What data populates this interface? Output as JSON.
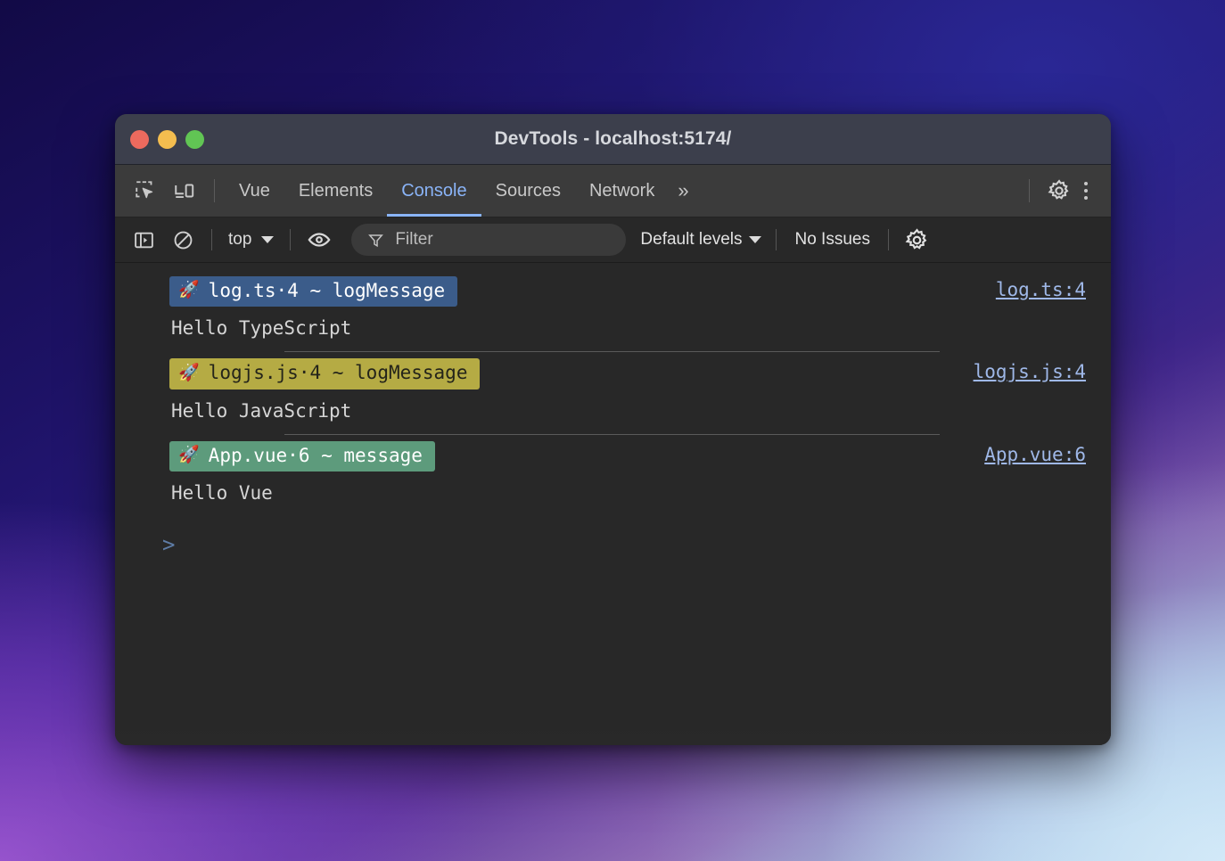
{
  "window": {
    "title": "DevTools - localhost:5174/",
    "traffic_lights": [
      {
        "name": "close",
        "color": "#ec6a5e"
      },
      {
        "name": "minimize",
        "color": "#f4bd4f"
      },
      {
        "name": "maximize",
        "color": "#61c554"
      }
    ]
  },
  "tabbar": {
    "inspect_icon": "inspect-element-icon",
    "device_icon": "device-toolbar-icon",
    "tabs": [
      {
        "label": "Vue",
        "active": false
      },
      {
        "label": "Elements",
        "active": false
      },
      {
        "label": "Console",
        "active": true
      },
      {
        "label": "Sources",
        "active": false
      },
      {
        "label": "Network",
        "active": false
      }
    ],
    "more_tabs_label": "»",
    "settings_icon": "gear-icon",
    "menu_icon": "kebab-menu-icon",
    "active_tab_color": "#8ab4f8"
  },
  "console_toolbar": {
    "sidebar_toggle_icon": "console-sidebar-icon",
    "clear_icon": "clear-console-icon",
    "context_value": "top",
    "eye_icon": "live-expression-eye-icon",
    "filter_icon": "filter-funnel-icon",
    "filter_placeholder": "Filter",
    "filter_value": "",
    "levels_label": "Default levels",
    "issues_label": "No Issues",
    "settings_icon": "gear-icon"
  },
  "console": {
    "prompt_symbol": ">",
    "entries": [
      {
        "badge_icon": "🚀",
        "badge_text": "log.ts·4 ~ logMessage",
        "badge_bg": "#3b5c8a",
        "badge_fg": "#ffffff",
        "message": "Hello TypeScript",
        "source": "log.ts:4"
      },
      {
        "badge_icon": "🚀",
        "badge_text": "logjs.js·4 ~ logMessage",
        "badge_bg": "#b5ab44",
        "badge_fg": "#2a2a1a",
        "message": "Hello JavaScript",
        "source": "logjs.js:4"
      },
      {
        "badge_icon": "🚀",
        "badge_text": "App.vue·6 ~ message",
        "badge_bg": "#5d9b7c",
        "badge_fg": "#ffffff",
        "message": "Hello Vue",
        "source": "App.vue:6"
      }
    ]
  }
}
